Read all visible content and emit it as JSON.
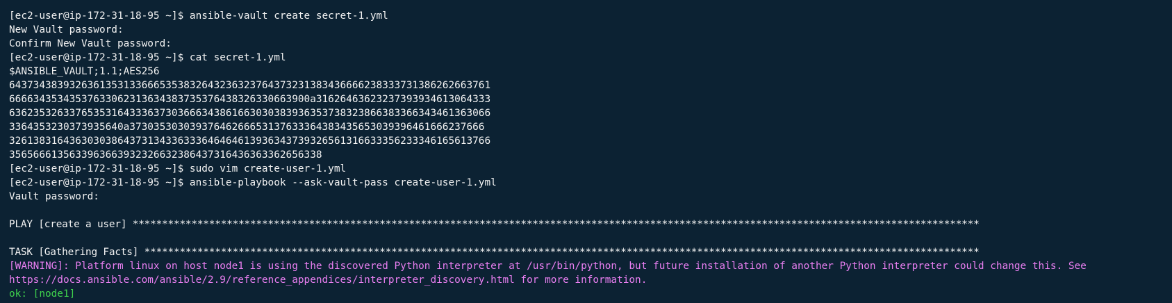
{
  "colors": {
    "background": "#0c2233",
    "text": "#f2f2f2",
    "warning": "#e97ff1",
    "ok": "#3fd14d"
  },
  "terminal": {
    "lines": [
      {
        "text": "[ec2-user@ip-172-31-18-95 ~]$ ansible-vault create secret-1.yml",
        "type": "prompt"
      },
      {
        "text": "New Vault password:",
        "type": "output"
      },
      {
        "text": "Confirm New Vault password:",
        "type": "output"
      },
      {
        "text": "[ec2-user@ip-172-31-18-95 ~]$ cat secret-1.yml",
        "type": "prompt"
      },
      {
        "text": "$ANSIBLE_VAULT;1.1;AES256",
        "type": "output"
      },
      {
        "text": "64373438393263613531336665353832643236323764373231383436666238333731386262663761",
        "type": "output"
      },
      {
        "text": "66663435343537633062313634383735376438326330663900a31626463623237393934613064333",
        "type": "output"
      },
      {
        "text": "63623532633765353164333637303666343861663030383936353738323866383366343461363066",
        "type": "output"
      },
      {
        "text": "3364353230373935640a37303530303937646266653137633364383435653039396461666237666",
        "type": "output"
      },
      {
        "text": "32613831643630303864373134336333646464613936343739326561316633356233346165613766",
        "type": "output"
      },
      {
        "text": "3565666135633963663932326632386437316436363362656338",
        "type": "output"
      },
      {
        "text": "[ec2-user@ip-172-31-18-95 ~]$ sudo vim create-user-1.yml",
        "type": "prompt"
      },
      {
        "text": "[ec2-user@ip-172-31-18-95 ~]$ ansible-playbook --ask-vault-pass create-user-1.yml",
        "type": "prompt"
      },
      {
        "text": "Vault password:",
        "type": "output"
      },
      {
        "text": "",
        "type": "blank"
      },
      {
        "text": "PLAY [create a user] ************************************************************************************************************************************************",
        "type": "play"
      },
      {
        "text": "",
        "type": "blank"
      },
      {
        "text": "TASK [Gathering Facts] **********************************************************************************************************************************************",
        "type": "task"
      },
      {
        "text": "[WARNING]: Platform linux on host node1 is using the discovered Python interpreter at /usr/bin/python, but future installation of another Python interpreter could change this. See",
        "type": "warning"
      },
      {
        "text": "https://docs.ansible.com/ansible/2.9/reference_appendices/interpreter_discovery.html for more information.",
        "type": "warning"
      },
      {
        "text": "ok: [node1]",
        "type": "ok"
      }
    ]
  }
}
